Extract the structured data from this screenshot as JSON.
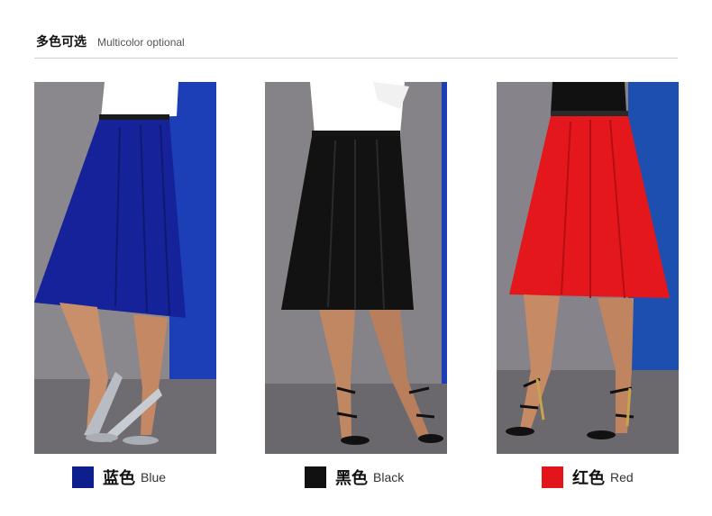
{
  "header": {
    "title_cn": "多色可选",
    "title_en": "Multicolor optional"
  },
  "colors": [
    {
      "name_cn": "蓝色",
      "name_en": "Blue",
      "hex": "#0d1f8c",
      "skirt": "#16229a",
      "top": "#ffffff",
      "bg_accent": "#1c3fb8"
    },
    {
      "name_cn": "黑色",
      "name_en": "Black",
      "hex": "#111111",
      "skirt": "#121212",
      "top": "#ffffff",
      "bg_accent": "#8a8a8e"
    },
    {
      "name_cn": "红色",
      "name_en": "Red",
      "hex": "#e2141c",
      "skirt": "#e4181c",
      "top": "#111111",
      "bg_accent": "#1c4fb0"
    }
  ]
}
